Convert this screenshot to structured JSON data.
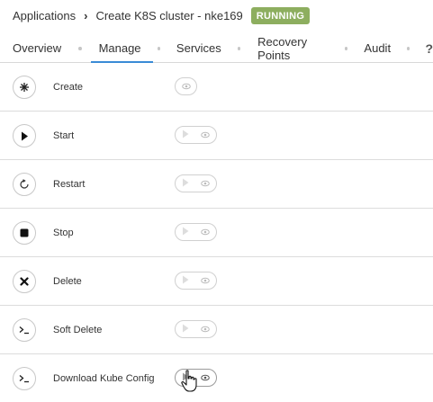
{
  "breadcrumb": {
    "root": "Applications",
    "current": "Create K8S cluster - nke169",
    "status": "RUNNING",
    "status_color": "#8dae5f"
  },
  "tabs": [
    "Overview",
    "Manage",
    "Services",
    "Recovery Points",
    "Audit",
    "?"
  ],
  "active_tab": "Manage",
  "actions": [
    {
      "label": "Create",
      "icon": "asterisk-icon",
      "controls": [
        "view"
      ]
    },
    {
      "label": "Start",
      "icon": "play-icon",
      "controls": [
        "run",
        "view"
      ]
    },
    {
      "label": "Restart",
      "icon": "restart-icon",
      "controls": [
        "run",
        "view"
      ]
    },
    {
      "label": "Stop",
      "icon": "stop-icon",
      "controls": [
        "run",
        "view"
      ]
    },
    {
      "label": "Delete",
      "icon": "close-icon",
      "controls": [
        "run",
        "view"
      ]
    },
    {
      "label": "Soft Delete",
      "icon": "terminal-icon",
      "controls": [
        "run",
        "view"
      ]
    },
    {
      "label": "Download Kube Config",
      "icon": "terminal-icon",
      "controls": [
        "run",
        "view"
      ]
    }
  ],
  "accent_color": "#3a8bd6"
}
